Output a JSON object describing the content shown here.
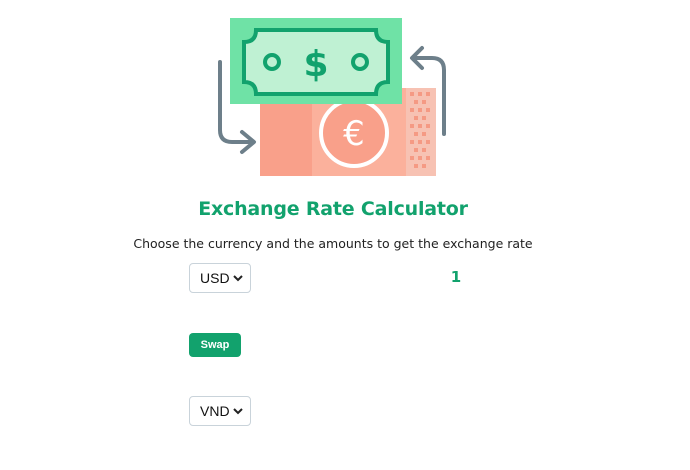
{
  "hero": {
    "illustration_icon": "currency-exchange-illustration",
    "dollar_symbol": "$",
    "euro_symbol": "€",
    "colors": {
      "dollar_bill": "#6fe2a6",
      "dollar_inner": "#bff1d3",
      "dollar_stroke": "#12a26d",
      "euro_bill": "#fbb19c",
      "euro_stroke": "#ffffff",
      "arrows": "#6d7f8a"
    }
  },
  "header": {
    "title": "Exchange Rate Calculator",
    "subtitle": "Choose the currency and the amounts to get the exchange rate"
  },
  "from_currency": {
    "selected": "USD",
    "chevron_icon": "chevron-down-icon"
  },
  "amount": {
    "value": "1"
  },
  "swap_button": {
    "label": "Swap"
  },
  "to_currency": {
    "selected": "VND",
    "chevron_icon": "chevron-down-icon"
  },
  "colors": {
    "accent": "#12a26d",
    "text": "#222222",
    "border": "#c9d3da"
  }
}
